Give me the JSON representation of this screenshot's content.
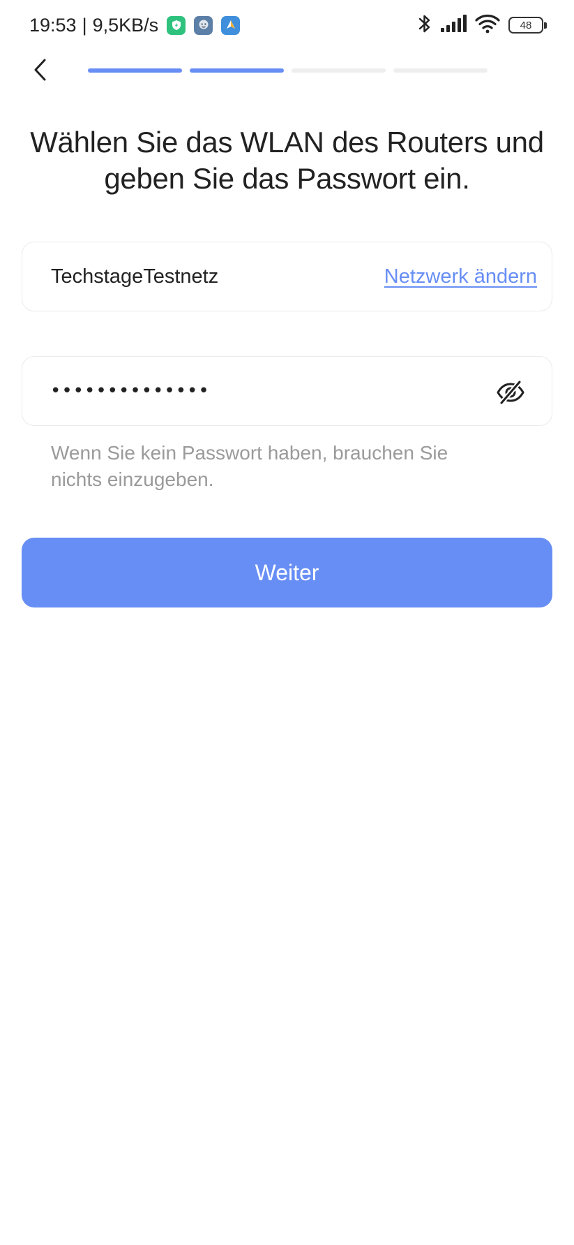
{
  "status_bar": {
    "time": "19:53",
    "separator": "|",
    "network_speed": "9,5KB/s",
    "battery_level": "48",
    "notification_icons": [
      "shield-app-icon",
      "avatar-app-icon",
      "navigation-app-icon"
    ],
    "system_icons": [
      "bluetooth-icon",
      "signal-icon",
      "wifi-icon",
      "battery-icon"
    ]
  },
  "header": {
    "back_icon": "chevron-left-icon",
    "progress": {
      "total_steps": 4,
      "completed_steps": 2
    }
  },
  "title": "Wählen Sie das WLAN des Routers und geben Sie das Passwort ein.",
  "network": {
    "ssid": "TechstageTestnetz",
    "change_link": "Netzwerk ändern"
  },
  "password": {
    "value": "••••••••••••••",
    "toggle_icon": "eye-off-icon"
  },
  "hint": "Wenn Sie kein Passwort haben, brauchen Sie nichts einzugeben.",
  "continue_button": "Weiter",
  "colors": {
    "accent": "#678ef5",
    "text_primary": "#222222",
    "text_hint": "#9a9a9a",
    "progress_inactive": "#eeeeee",
    "border": "#ebebeb"
  }
}
